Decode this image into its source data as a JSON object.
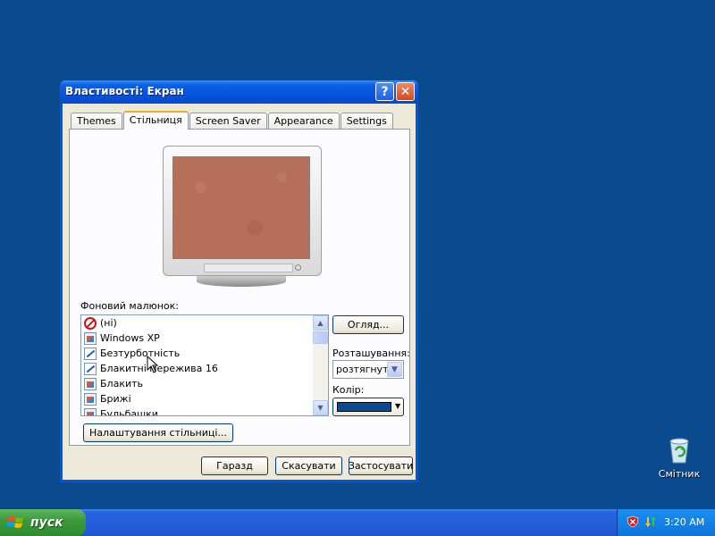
{
  "window": {
    "title": "Властивості: Екран",
    "help_label": "?",
    "close_label": "✕"
  },
  "tabs": [
    {
      "label": "Themes",
      "active": false
    },
    {
      "label": "Стільниця",
      "active": true
    },
    {
      "label": "Screen Saver",
      "active": false
    },
    {
      "label": "Appearance",
      "active": false
    },
    {
      "label": "Settings",
      "active": false
    }
  ],
  "desktop_tab": {
    "background_label": "Фоновий малюнок:",
    "items": [
      {
        "label": "(ні)",
        "icon": "none-icon"
      },
      {
        "label": "Windows XP",
        "icon": "bitmap-icon"
      },
      {
        "label": "Безтурботність",
        "icon": "jpeg-icon"
      },
      {
        "label": "Блакитні мережива 16",
        "icon": "jpeg-icon"
      },
      {
        "label": "Блакить",
        "icon": "bitmap-icon"
      },
      {
        "label": "Брижі",
        "icon": "bitmap-icon"
      },
      {
        "label": "Бульбашки",
        "icon": "bitmap-icon"
      }
    ],
    "browse_label": "Огляд...",
    "position_label": "Розташування:",
    "position_value": "розтягнути",
    "color_label": "Колір:",
    "color_value": "#0a4a8e",
    "customize_label": "Налаштування стільниці..."
  },
  "buttons": {
    "ok": "Гаразд",
    "cancel": "Скасувати",
    "apply": "Застосувати"
  },
  "desktop": {
    "recycle_bin_label": "Смітник",
    "background_color": "#0a4a8e"
  },
  "taskbar": {
    "start_label": "пуск",
    "clock": "3:20 AM"
  }
}
